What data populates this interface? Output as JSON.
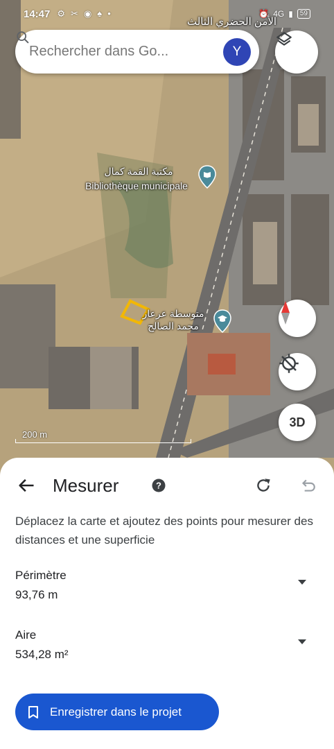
{
  "status_bar": {
    "time": "14:47",
    "battery": "59",
    "network": "4G"
  },
  "search": {
    "placeholder": "Rechercher dans Go...",
    "avatar_letter": "Y"
  },
  "map": {
    "label_top_right": "الأمن الحضري الثالث",
    "poi_library_ar": "مكتبة القمة كمال",
    "poi_library_fr": "Bibliothèque municipale",
    "poi_school_ar_1": "متوسطة عرعار",
    "poi_school_ar_2": "محمد الصالح",
    "scale_label": "200 m",
    "threed_label": "3D"
  },
  "sheet": {
    "title": "Mesurer",
    "instructions": "Déplacez la carte et ajoutez des points pour mesurer des distances et une superficie",
    "perimeter_label": "Périmètre",
    "perimeter_value": "93,76 m",
    "area_label": "Aire",
    "area_value": "534,28 m²",
    "save_label": "Enregistrer dans le projet"
  },
  "colors": {
    "accent": "#1a57d0",
    "avatar": "#2f45b5",
    "measure_polygon": "#f2b705"
  }
}
